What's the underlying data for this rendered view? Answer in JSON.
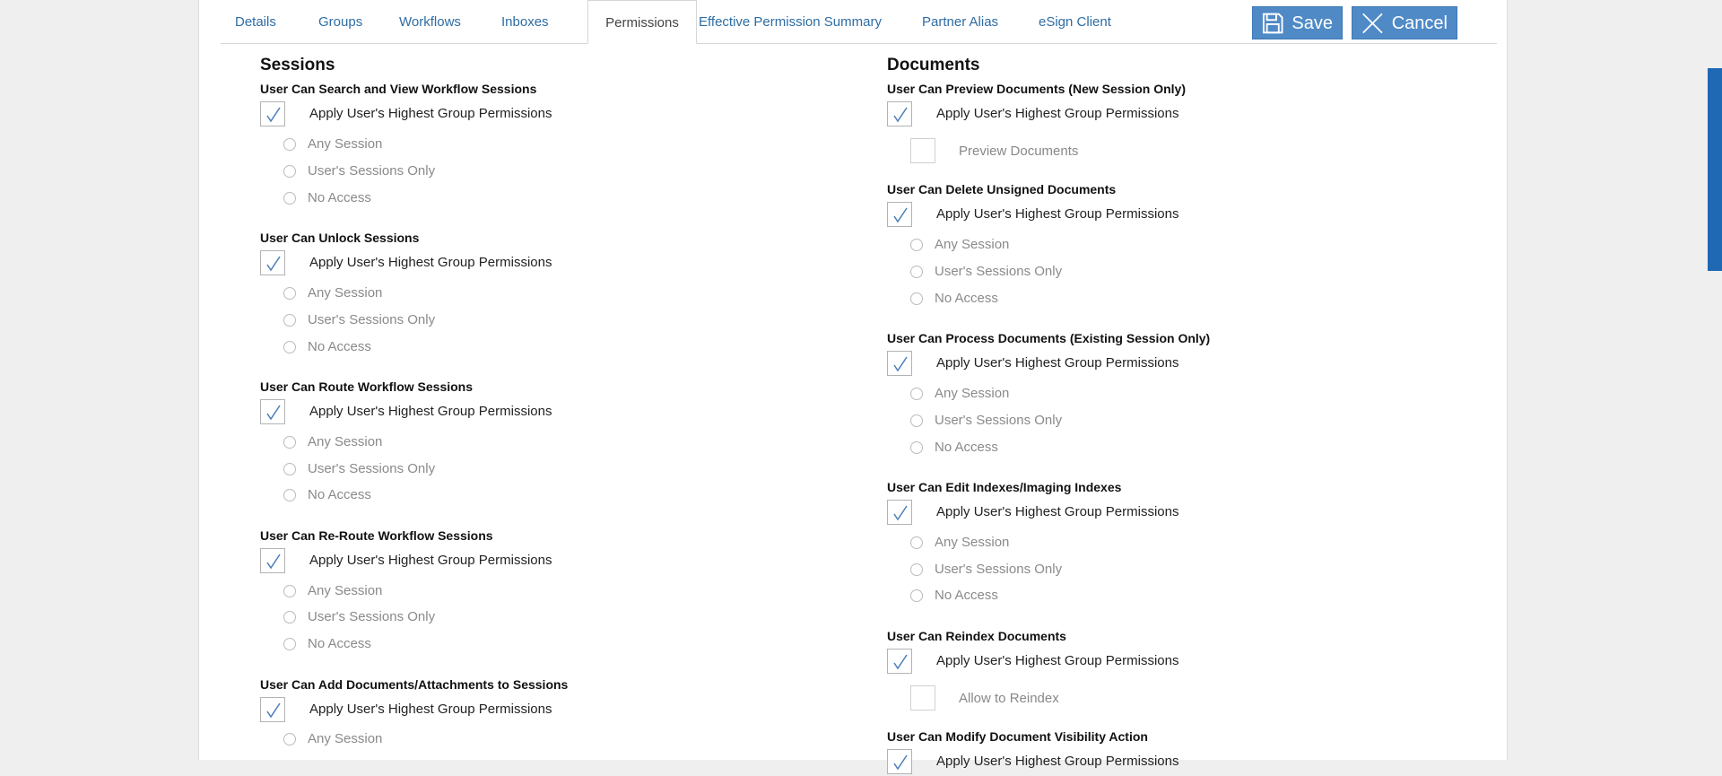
{
  "tabs": [
    {
      "label": "Details",
      "active": false
    },
    {
      "label": "Groups",
      "active": false
    },
    {
      "label": "Workflows",
      "active": false
    },
    {
      "label": "Inboxes",
      "active": false
    },
    {
      "label": "Permissions",
      "active": true
    },
    {
      "label": "Effective Permission Summary",
      "active": false
    },
    {
      "label": "Partner Alias",
      "active": false
    },
    {
      "label": "eSign Client",
      "active": false
    }
  ],
  "toolbar": {
    "save_label": "Save",
    "save_icon": "floppy-disk-icon",
    "cancel_label": "Cancel",
    "cancel_icon": "close-icon"
  },
  "colors": {
    "accent": "#4f8ac7",
    "link": "#2e6da4",
    "scrollbar": "#1f68b4"
  },
  "sessions": {
    "title": "Sessions",
    "groups": [
      {
        "title": "User Can Search and View Workflow Sessions",
        "apply_label": "Apply User's Highest Group Permissions",
        "apply_checked": true,
        "options": [
          "Any Session",
          "User's Sessions Only",
          "No Access"
        ]
      },
      {
        "title": "User Can Unlock Sessions",
        "apply_label": "Apply User's Highest Group Permissions",
        "apply_checked": true,
        "options": [
          "Any Session",
          "User's Sessions Only",
          "No Access"
        ]
      },
      {
        "title": "User Can Route Workflow Sessions",
        "apply_label": "Apply User's Highest Group Permissions",
        "apply_checked": true,
        "options": [
          "Any Session",
          "User's Sessions Only",
          "No Access"
        ]
      },
      {
        "title": "User Can Re-Route Workflow Sessions",
        "apply_label": "Apply User's Highest Group Permissions",
        "apply_checked": true,
        "options": [
          "Any Session",
          "User's Sessions Only",
          "No Access"
        ]
      },
      {
        "title": "User Can Add Documents/Attachments to Sessions",
        "apply_label": "Apply User's Highest Group Permissions",
        "apply_checked": true,
        "options": [
          "Any Session"
        ]
      }
    ]
  },
  "documents": {
    "title": "Documents",
    "groups": [
      {
        "title": "User Can Preview Documents (New Session Only)",
        "apply_label": "Apply User's Highest Group Permissions",
        "apply_checked": true,
        "sub_checkbox": "Preview Documents"
      },
      {
        "title": "User Can Delete Unsigned Documents",
        "apply_label": "Apply User's Highest Group Permissions",
        "apply_checked": true,
        "options": [
          "Any Session",
          "User's Sessions Only",
          "No Access"
        ]
      },
      {
        "title": "User Can Process Documents (Existing Session Only)",
        "apply_label": "Apply User's Highest Group Permissions",
        "apply_checked": true,
        "options": [
          "Any Session",
          "User's Sessions Only",
          "No Access"
        ]
      },
      {
        "title": "User Can Edit Indexes/Imaging Indexes",
        "apply_label": "Apply User's Highest Group Permissions",
        "apply_checked": true,
        "options": [
          "Any Session",
          "User's Sessions Only",
          "No Access"
        ]
      },
      {
        "title": "User Can Reindex Documents",
        "apply_label": "Apply User's Highest Group Permissions",
        "apply_checked": true,
        "sub_checkbox": "Allow to Reindex"
      },
      {
        "title": "User Can Modify Document Visibility Action",
        "apply_label": "Apply User's Highest Group Permissions",
        "apply_checked": true
      }
    ]
  }
}
